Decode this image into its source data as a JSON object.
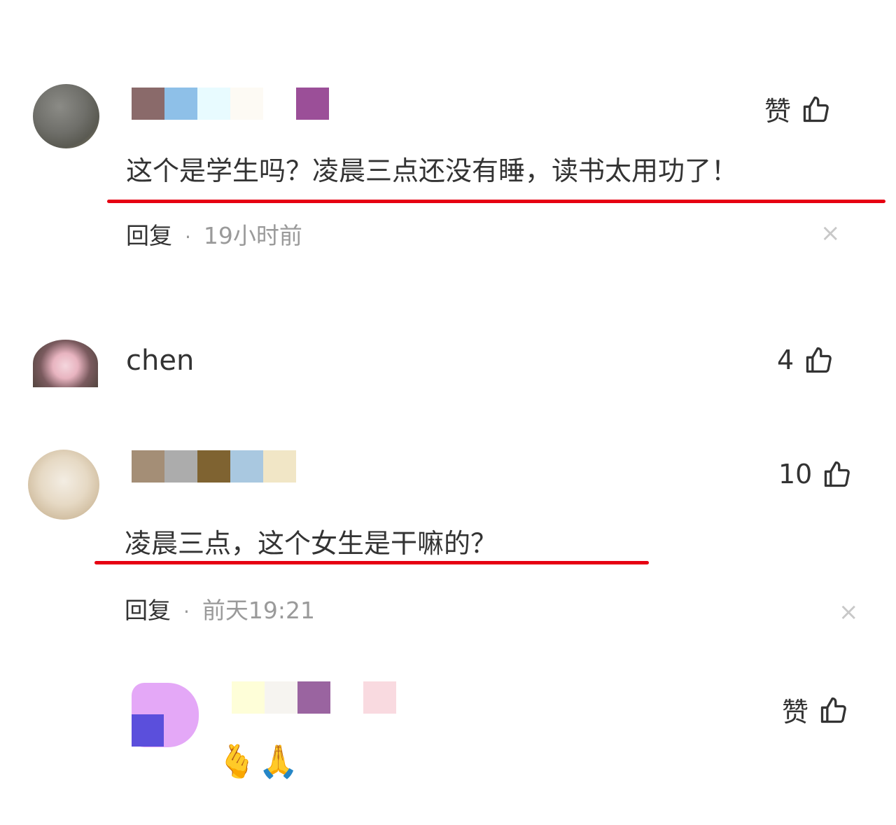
{
  "comments": [
    {
      "text": "这个是学生吗？凌晨三点还没有睡，读书太用功了！",
      "reply_label": "回复",
      "separator": "·",
      "time": "19小时前",
      "like_label": "赞",
      "close_symbol": "×",
      "name_mosaic": [
        "#8a6a6a",
        "#8ec0e8",
        "#e8fbff",
        "#fdfaf4",
        "#ffffff",
        "#9b4f98"
      ]
    },
    {
      "username": "chen",
      "like_count": "4"
    },
    {
      "text": "凌晨三点，这个女生是干嘛的？",
      "reply_label": "回复",
      "separator": "·",
      "time": "前天19:21",
      "like_count": "10",
      "close_symbol": "×",
      "name_mosaic": [
        "#a48e76",
        "#acacac",
        "#7f6331",
        "#a9c8e0",
        "#f1e6c6"
      ]
    },
    {
      "like_label": "赞",
      "emoji_text": "🫰🙏",
      "name_mosaic": [
        "#ffffff",
        "#fefed8",
        "#f6f4f0",
        "#9a64a0",
        "#ffffff",
        "#f9dae0"
      ]
    }
  ],
  "colors": {
    "underline": "#e60012",
    "muted": "#9a9a9a",
    "text": "#333333"
  }
}
